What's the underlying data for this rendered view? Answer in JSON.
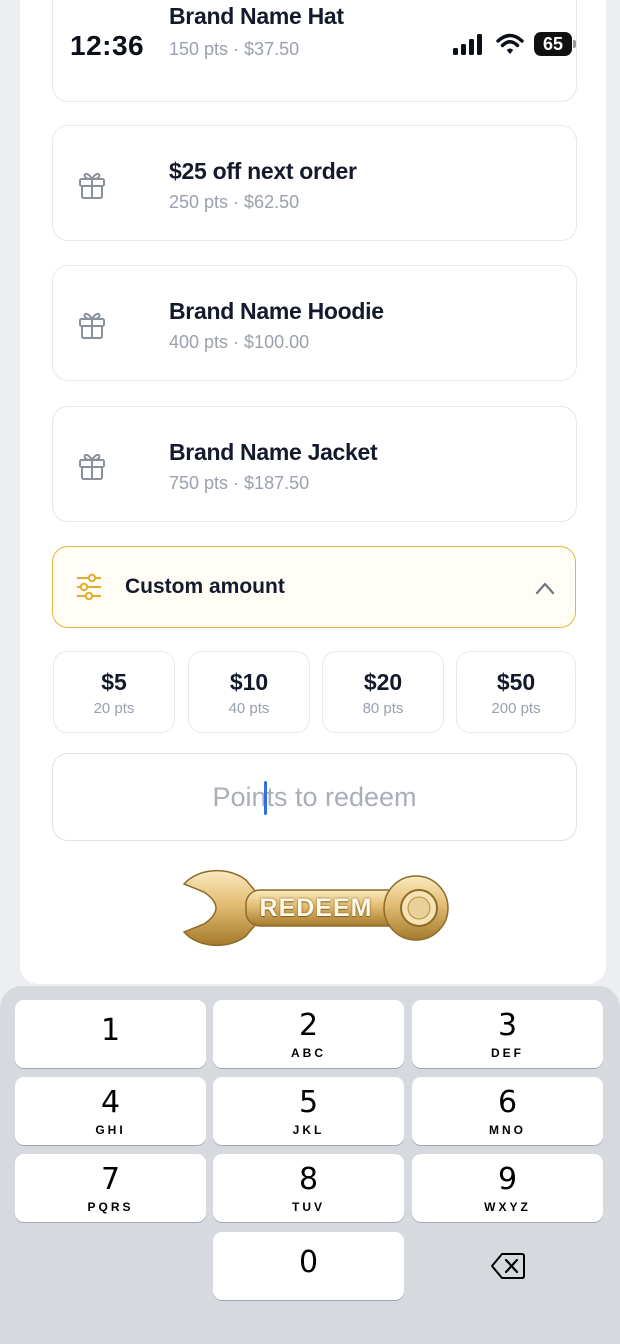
{
  "status_bar": {
    "time": "12:36",
    "battery": "65"
  },
  "rewards": [
    {
      "title": "Brand Name Hat",
      "subtitle": "150 pts · $37.50",
      "icon": "gift-icon"
    },
    {
      "title": "$25 off next order",
      "subtitle": "250 pts · $62.50",
      "icon": "gift-icon"
    },
    {
      "title": "Brand Name Hoodie",
      "subtitle": "400 pts · $100.00",
      "icon": "gift-icon"
    },
    {
      "title": "Brand Name Jacket",
      "subtitle": "750 pts · $187.50",
      "icon": "gift-icon"
    }
  ],
  "custom_amount": {
    "label": "Custom amount",
    "icon": "sliders-icon",
    "expanded": true,
    "accent": "#e4b73a"
  },
  "quick_amounts": [
    {
      "amount": "$5",
      "points": "20 pts"
    },
    {
      "amount": "$10",
      "points": "40 pts"
    },
    {
      "amount": "$20",
      "points": "80 pts"
    },
    {
      "amount": "$50",
      "points": "200 pts"
    }
  ],
  "points_input": {
    "placeholder": "Points to redeem",
    "value": ""
  },
  "redeem_button": {
    "label": "REDEEM",
    "icon": "wrench-icon",
    "color": "#d9b46a"
  },
  "keypad": {
    "keys": [
      {
        "num": "1",
        "letters": ""
      },
      {
        "num": "2",
        "letters": "ABC"
      },
      {
        "num": "3",
        "letters": "DEF"
      },
      {
        "num": "4",
        "letters": "GHI"
      },
      {
        "num": "5",
        "letters": "JKL"
      },
      {
        "num": "6",
        "letters": "MNO"
      },
      {
        "num": "7",
        "letters": "PQRS"
      },
      {
        "num": "8",
        "letters": "TUV"
      },
      {
        "num": "9",
        "letters": "WXYZ"
      },
      {
        "num": "0",
        "letters": ""
      }
    ],
    "delete_icon": "backspace-icon"
  }
}
